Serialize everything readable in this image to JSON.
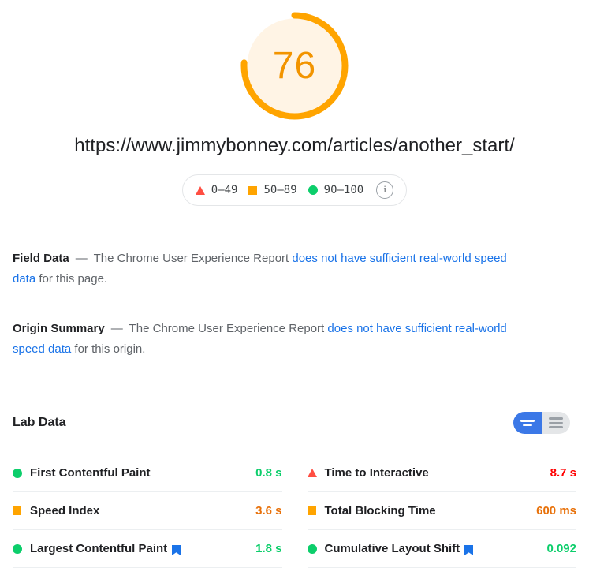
{
  "score": {
    "value": "76",
    "percent": 76,
    "ring_color": "#ffa400",
    "fill_color": "#fff4e5"
  },
  "page_url": "https://www.jimmybonney.com/articles/another_start/",
  "legend": {
    "items": [
      {
        "icon": "triangle-icon",
        "label": "0–49",
        "color": "#ff4e42"
      },
      {
        "icon": "square-icon",
        "label": "50–89",
        "color": "#ffa400"
      },
      {
        "icon": "circle-icon",
        "label": "90–100",
        "color": "#0cce6b"
      }
    ],
    "info_label": "i"
  },
  "field_data": {
    "title": "Field Data",
    "dash": "—",
    "text_before": "The Chrome User Experience Report",
    "link": "does not have sufficient real-world speed data",
    "text_after": "for this page."
  },
  "origin_summary": {
    "title": "Origin Summary",
    "dash": "—",
    "text_before": "The Chrome User Experience Report",
    "link": "does not have sufficient real-world speed data",
    "text_after": "for this origin."
  },
  "lab_data": {
    "title": "Lab Data",
    "toggle": {
      "active": "two-line-view",
      "options": [
        "two-line-view",
        "three-line-view"
      ]
    },
    "columns": [
      {
        "rows": [
          {
            "status": "circle-icon",
            "status_color": "#0cce6b",
            "label": "First Contentful Paint",
            "value": "0.8 s",
            "value_class": "v-green",
            "cwv": false
          },
          {
            "status": "square-icon",
            "status_color": "#ffa400",
            "label": "Speed Index",
            "value": "3.6 s",
            "value_class": "v-orange",
            "cwv": false
          },
          {
            "status": "circle-icon",
            "status_color": "#0cce6b",
            "label": "Largest Contentful Paint",
            "value": "1.8 s",
            "value_class": "v-green",
            "cwv": true
          }
        ]
      },
      {
        "rows": [
          {
            "status": "triangle-icon",
            "status_color": "#ff4e42",
            "label": "Time to Interactive",
            "value": "8.7 s",
            "value_class": "v-red",
            "cwv": false
          },
          {
            "status": "square-icon",
            "status_color": "#ffa400",
            "label": "Total Blocking Time",
            "value": "600 ms",
            "value_class": "v-orange",
            "cwv": false
          },
          {
            "status": "circle-icon",
            "status_color": "#0cce6b",
            "label": "Cumulative Layout Shift",
            "value": "0.092",
            "value_class": "v-green",
            "cwv": true
          }
        ]
      }
    ]
  }
}
